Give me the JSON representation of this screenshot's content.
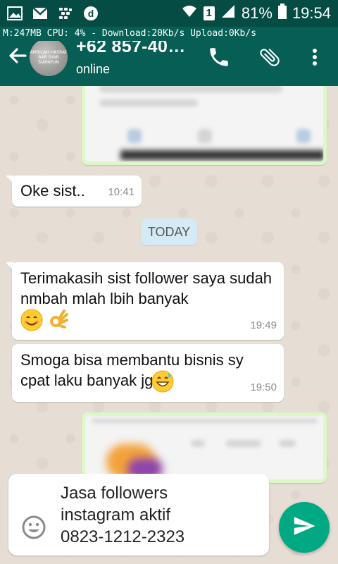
{
  "status_bar": {
    "battery": "81%",
    "time": "19:54",
    "sim_badge": "1",
    "icons": [
      "gallery-icon",
      "gmail-icon",
      "bbm-icon",
      "d-app-icon",
      "wifi-icon",
      "signal-icon",
      "battery-icon"
    ]
  },
  "monitor": {
    "text": "M:247MB   CPU: 4%   - Download:20Kb/s  Upload:0Kb/s"
  },
  "header": {
    "contact_name": "+62 857-40…",
    "status": "online",
    "avatar_text": "AMBILAH HASRAT BAR SYAR SIAPAPUN"
  },
  "messages": [
    {
      "text": "Oke sist..",
      "time": "10:41",
      "direction": "in"
    },
    {
      "text": "Terimakasih sist follower saya sudah nmbah mlah lbih banyak",
      "emojis": [
        "smiling-face-icon",
        "ok-hand-icon"
      ],
      "time": "19:49",
      "direction": "in"
    },
    {
      "text": "Smoga bisa membantu bisnis sy cpat laku banyak jg",
      "emojis": [
        "grinning-sweat-face-icon"
      ],
      "time": "19:50",
      "direction": "in"
    }
  ],
  "date_divider": "TODAY",
  "composer": {
    "text": "Jasa followers\ninstagram aktif\n0823-1212-2323"
  },
  "colors": {
    "header": "#075e54",
    "status_bar": "#054d44",
    "outgoing_bubble": "#dcf8c6",
    "date_pill": "#d4eaf4",
    "send_button": "#00a884"
  }
}
